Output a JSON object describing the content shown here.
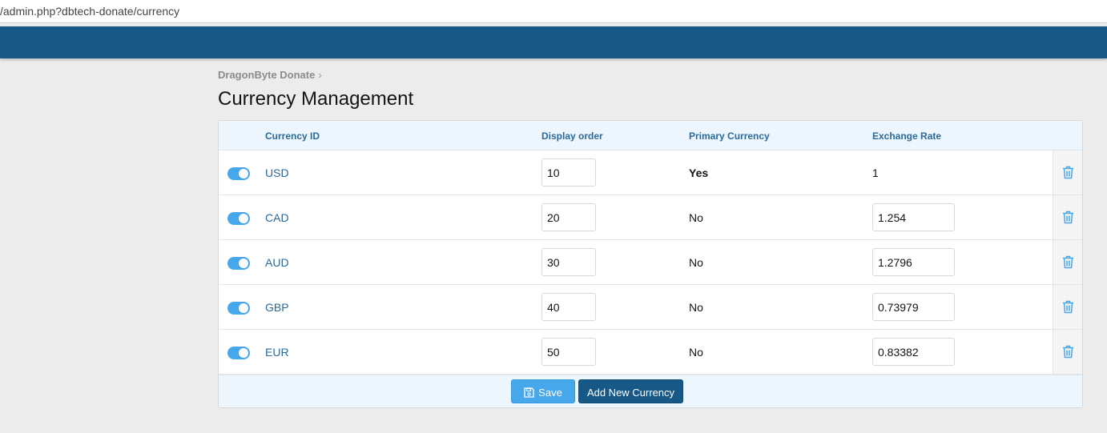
{
  "browser": {
    "url": "/admin.php?dbtech-donate/currency"
  },
  "breadcrumb": {
    "item": "DragonByte Donate",
    "chevron": "›"
  },
  "page": {
    "title": "Currency Management"
  },
  "table": {
    "headers": {
      "currency_id": "Currency ID",
      "display_order": "Display order",
      "primary_currency": "Primary Currency",
      "exchange_rate": "Exchange Rate"
    },
    "rows": [
      {
        "currency_id": "USD",
        "display_order": "10",
        "primary": "Yes",
        "exchange_rate": "1",
        "enabled": true
      },
      {
        "currency_id": "CAD",
        "display_order": "20",
        "primary": "No",
        "exchange_rate": "1.254",
        "enabled": true
      },
      {
        "currency_id": "AUD",
        "display_order": "30",
        "primary": "No",
        "exchange_rate": "1.2796",
        "enabled": true
      },
      {
        "currency_id": "GBP",
        "display_order": "40",
        "primary": "No",
        "exchange_rate": "0.73979",
        "enabled": true
      },
      {
        "currency_id": "EUR",
        "display_order": "50",
        "primary": "No",
        "exchange_rate": "0.83382",
        "enabled": true
      }
    ]
  },
  "footer": {
    "save_label": "Save",
    "add_label": "Add New Currency"
  },
  "icons": {
    "toggle": "toggle-on-icon",
    "delete": "trash-icon",
    "save": "floppy-disk-icon"
  },
  "colors": {
    "header_bar": "#185886",
    "accent": "#47a7eb",
    "link": "#2b6a99"
  }
}
